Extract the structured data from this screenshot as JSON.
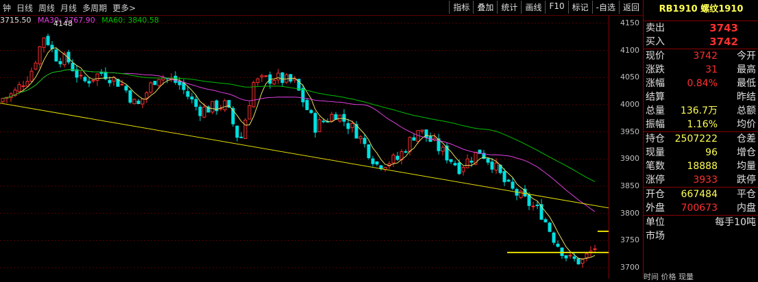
{
  "toolbar": {
    "periods": [
      "钟",
      "日线",
      "周线",
      "月线",
      "多周期",
      "更多>"
    ],
    "tools": [
      "指标",
      "叠加",
      "统计",
      "画线",
      "F10",
      "标记",
      "-自选",
      "返回"
    ]
  },
  "ma_legend": {
    "price": "3715.50",
    "ma30": "MA30: 3767.90",
    "ma60": "MA60: 3840.58",
    "colors": {
      "ma30": "#e040e0",
      "ma60": "#00c000",
      "price": "#e0e0e0"
    }
  },
  "chart_data": {
    "type": "candlestick",
    "high_label": "4148",
    "yticks": [
      "4150",
      "4100",
      "4050",
      "4000",
      "3950",
      "3900",
      "3850",
      "3800",
      "3750",
      "3700"
    ],
    "ylim": [
      3680,
      4165
    ],
    "colors": {
      "up": "#ff3030",
      "down": "#00e0e0",
      "ma30": "#e040e0",
      "ma60": "#00c000",
      "ma_short": "#e8e060",
      "trendline": "#e8e000"
    }
  },
  "panel": {
    "title_code": "RB1910",
    "title_name": "螺纹1910",
    "sell_label": "卖出",
    "sell_value": "3743",
    "buy_label": "买入",
    "buy_value": "3742",
    "rows1": [
      {
        "l": "现价",
        "v": "3742",
        "r": "今开"
      },
      {
        "l": "涨跌",
        "v": "31",
        "r": "最高"
      },
      {
        "l": "涨幅",
        "v": "0.84%",
        "r": "最低"
      },
      {
        "l": "结算",
        "v": "",
        "r": "昨结"
      },
      {
        "l": "总量",
        "v": "136.7万",
        "r": "总额"
      },
      {
        "l": "振幅",
        "v": "1.16%",
        "r": "均价"
      }
    ],
    "rows2": [
      {
        "l": "持仓",
        "v": "2507222",
        "r": "仓差"
      },
      {
        "l": "现量",
        "v": "96",
        "r": "增仓"
      },
      {
        "l": "笔数",
        "v": "18888",
        "r": "均量"
      },
      {
        "l": "涨停",
        "v": "3933",
        "r": "跌停"
      }
    ],
    "rows3": [
      {
        "l": "开仓",
        "v": "667484",
        "r": "平仓"
      },
      {
        "l": "外盘",
        "v": "700673",
        "r": "内盘"
      }
    ],
    "unit_label": "单位",
    "unit_value": "每手10吨",
    "market_label": "市场",
    "bottom": "时间          价格       现量"
  }
}
